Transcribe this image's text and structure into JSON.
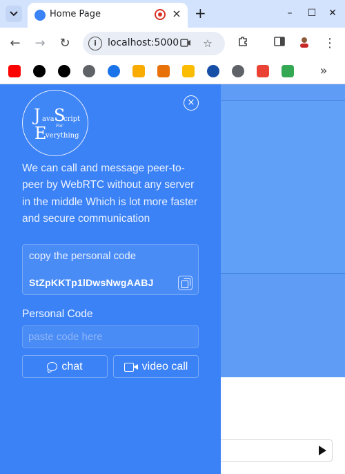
{
  "browser": {
    "tab_title": "Home Page",
    "tab_close": "×",
    "new_tab": "+",
    "url": "localhost:5000",
    "window_controls": {
      "minimize": "–",
      "maximize": "☐",
      "close": "✕"
    },
    "nav": {
      "back": "←",
      "forward": "→",
      "reload": "↻",
      "more": "⋮"
    },
    "bookmarks_overflow": "»"
  },
  "sidebar": {
    "logo": {
      "word1": "JavaScript",
      "word2": "For",
      "word3": "Everything"
    },
    "close_icon": "×",
    "intro_text": "We can call and message peer-to-peer by WebRTC without any server in the middle Which is lot more faster and secure communication",
    "copy_card": {
      "label": "copy the personal code",
      "code": "StZpKKTp1lDwsNwgAABJ"
    },
    "personal_code": {
      "label": "Personal Code",
      "placeholder": "paste code here"
    },
    "buttons": {
      "chat": "chat",
      "video_call": "video call"
    }
  },
  "colors": {
    "sidebar_bg": "#3b82f6",
    "main_panel": "#60a0f7",
    "browser_tabstrip": "#d3e3fd"
  }
}
